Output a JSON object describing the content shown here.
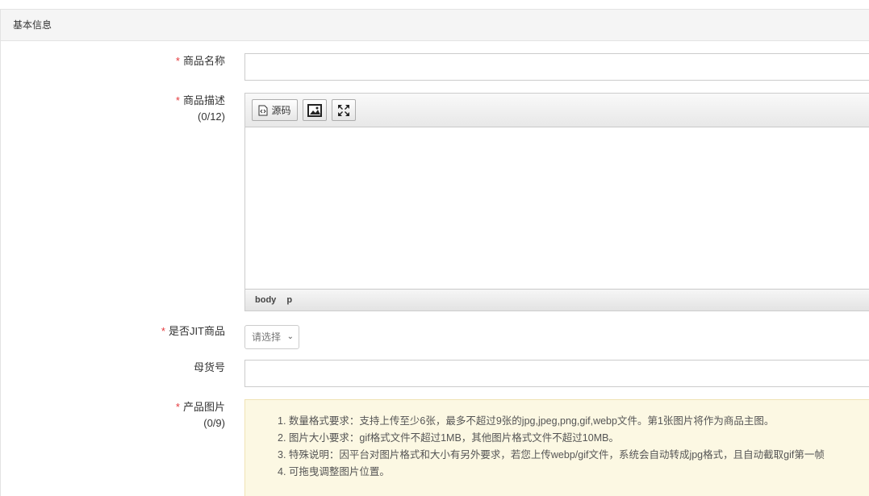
{
  "panel": {
    "title": "基本信息"
  },
  "form": {
    "required_mark": "*",
    "product_name": {
      "label": "商品名称",
      "value": ""
    },
    "product_desc": {
      "label": "商品描述",
      "counter": "(0/12)",
      "toolbar": {
        "source_label": "源码"
      },
      "status_path": [
        "body",
        "p"
      ]
    },
    "jit": {
      "label": "是否JIT商品",
      "selected": "请选择"
    },
    "parent_sku": {
      "label": "母货号",
      "value": ""
    },
    "product_images": {
      "label": "产品图片",
      "counter": "(0/9)",
      "notes": [
        "1. 数量格式要求：支持上传至少6张，最多不超过9张的jpg,jpeg,png,gif,webp文件。第1张图片将作为商品主图。",
        "2. 图片大小要求：gif格式文件不超过1MB，其他图片格式文件不超过10MB。",
        "3. 特殊说明：因平台对图片格式和大小有另外要求，若您上传webp/gif文件，系统会自动转成jpg格式，且自动截取gif第一帧",
        "4. 可拖曳调整图片位置。"
      ]
    }
  }
}
